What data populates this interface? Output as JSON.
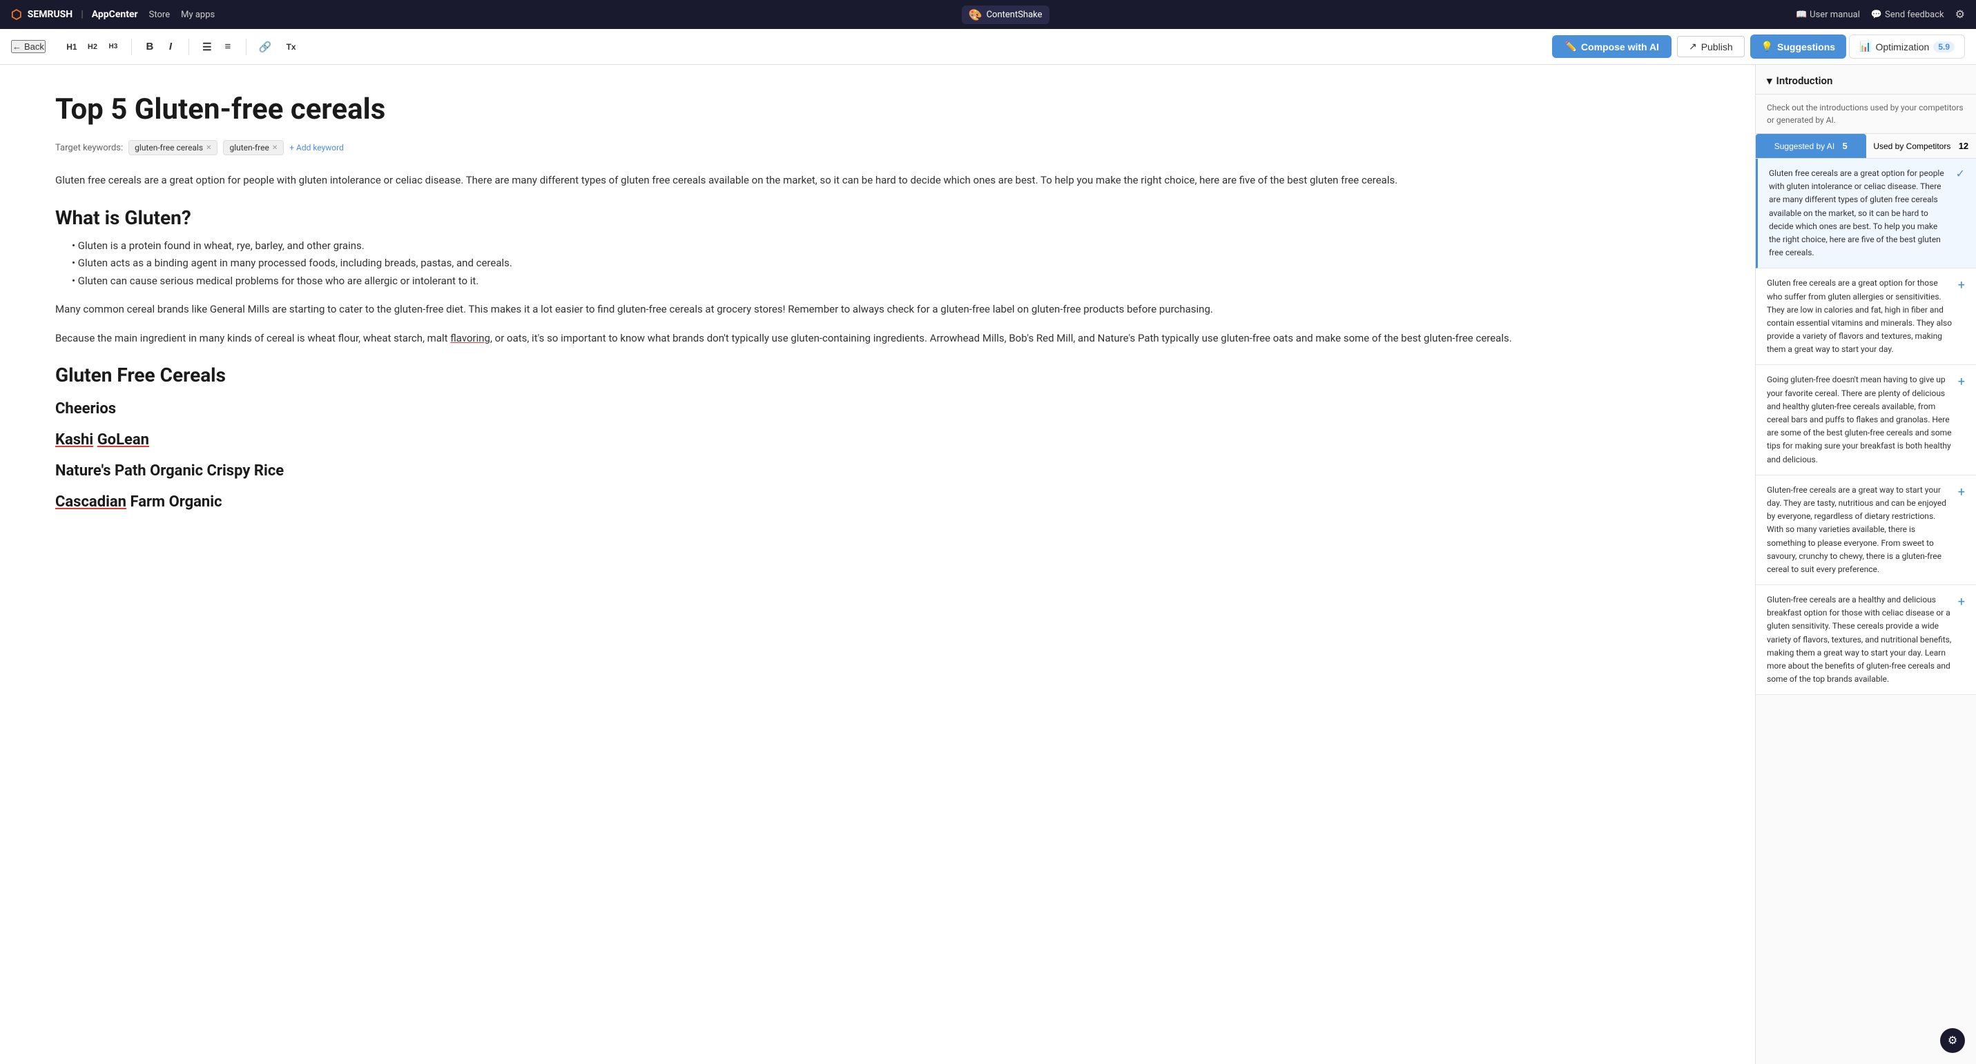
{
  "topbar": {
    "brand": "SEMRUSH",
    "appcenter": "AppCenter",
    "store": "Store",
    "myapps": "My apps",
    "app_name": "ContentShake",
    "user_manual": "User manual",
    "send_feedback": "Send feedback"
  },
  "toolbar": {
    "back": "Back",
    "h1": "H1",
    "h2": "H2",
    "h3": "H3",
    "bold": "B",
    "italic": "I",
    "list_ordered": "≡",
    "list_bullet": "≡",
    "link": "🔗",
    "clear": "Tx",
    "compose_ai": "Compose with AI",
    "publish": "Publish",
    "suggestions_label": "Suggestions",
    "optimization_label": "Optimization",
    "optimization_score": "5.9"
  },
  "editor": {
    "title": "Top 5 Gluten-free cereals",
    "keywords_label": "Target keywords:",
    "keywords": [
      {
        "text": "gluten-free cereals"
      },
      {
        "text": "gluten-free"
      }
    ],
    "add_keyword": "+ Add keyword",
    "paragraphs": [
      "Gluten free cereals are a great option for people with gluten intolerance or celiac disease. There are many different types of gluten free cereals available on the market, so it can be hard to decide which ones are best. To help you make the right choice, here are five of the best gluten free cereals.",
      "Many common cereal brands like General Mills are starting to cater to the gluten-free diet. This makes it a lot easier to find gluten-free cereals at grocery stores! Remember to always check for a gluten-free label on gluten-free products before purchasing.",
      "Because the main ingredient in many kinds of cereal is wheat flour, wheat starch, malt flavoring, or oats, it's so important to know what brands don't typically use gluten-containing ingredients. Arrowhead Mills, Bob's Red Mill, and Nature's Path typically use gluten-free oats and make some of the best gluten-free cereals."
    ],
    "section1_title": "What is Gluten?",
    "bullets": [
      "Gluten is a protein found in wheat, rye, barley, and other grains.",
      "Gluten acts as a binding agent in many processed foods, including breads, pastas, and cereals.",
      "Gluten can cause serious medical problems for those who are allergic or intolerant to it."
    ],
    "section2_title": "Gluten Free Cereals",
    "section3_title": "Cheerios",
    "section4_title": "Kashi GoLean",
    "section5_title": "Nature's Path Organic Crispy Rice",
    "section6_title": "Cascadian Farm Organic"
  },
  "right_panel": {
    "section_title": "Introduction",
    "section_desc": "Check out the introductions used by your competitors or generated by AI.",
    "tab_ai": "Suggested by AI",
    "tab_ai_count": "5",
    "tab_competitors": "Used by Competitors",
    "tab_competitors_count": "12",
    "suggestions": [
      {
        "text": "Gluten free cereals are a great option for people with gluten intolerance or celiac disease. There are many different types of gluten free cereals available on the market, so it can be hard to decide which ones are best. To help you make the right choice, here are five of the best gluten free cereals.",
        "active": true
      },
      {
        "text": "Gluten free cereals are a great option for those who suffer from gluten allergies or sensitivities. They are low in calories and fat, high in fiber and contain essential vitamins and minerals. They also provide a variety of flavors and textures, making them a great way to start your day.",
        "active": false
      },
      {
        "text": "Going gluten-free doesn't mean having to give up your favorite cereal. There are plenty of delicious and healthy gluten-free cereals available, from cereal bars and puffs to flakes and granolas. Here are some of the best gluten-free cereals and some tips for making sure your breakfast is both healthy and delicious.",
        "active": false
      },
      {
        "text": "Gluten-free cereals are a great way to start your day. They are tasty, nutritious and can be enjoyed by everyone, regardless of dietary restrictions. With so many varieties available, there is something to please everyone. From sweet to savoury, crunchy to chewy, there is a gluten-free cereal to suit every preference.",
        "active": false
      },
      {
        "text": "Gluten-free cereals are a healthy and delicious breakfast option for those with celiac disease or a gluten sensitivity. These cereals provide a wide variety of flavors, textures, and nutritional benefits, making them a great way to start your day. Learn more about the benefits of gluten-free cereals and some of the top brands available.",
        "active": false
      }
    ]
  }
}
